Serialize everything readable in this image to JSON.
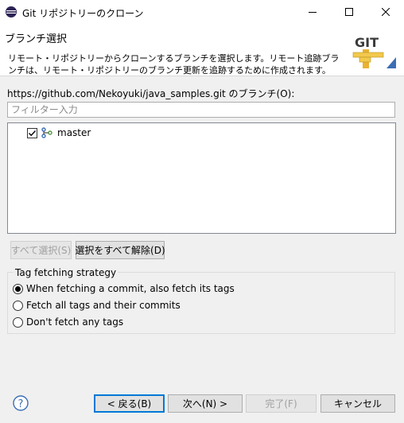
{
  "window": {
    "title": "Git リポジトリーのクローン",
    "icon": "eclipse-icon"
  },
  "banner": {
    "title": "ブランチ選択",
    "description": "リモート・リポジトリーからクローンするブランチを選択します。リモート追跡ブランチは、リモート・リポジトリーのブランチ更新を追跡するために作成されます。",
    "logo_text": "GIT"
  },
  "branches": {
    "label": "https://github.com/Nekoyuki/java_samples.git のブランチ(O):",
    "filter_placeholder": "フィルター入力",
    "items": [
      {
        "name": "master",
        "checked": true,
        "icon": "branch-icon"
      }
    ]
  },
  "selection_buttons": {
    "select_all": "すべて選択(S)",
    "deselect_all": "選択をすべて解除(D)"
  },
  "tag_strategy": {
    "legend": "Tag fetching strategy",
    "options": [
      {
        "label": "When fetching a commit, also fetch its tags",
        "selected": true
      },
      {
        "label": "Fetch all tags and their commits",
        "selected": false
      },
      {
        "label": "Don't fetch any tags",
        "selected": false
      }
    ]
  },
  "footer": {
    "help_icon": "help-icon",
    "back": "< 戻る(B)",
    "next": "次へ(N) >",
    "finish": "完了(F)",
    "cancel": "キャンセル"
  },
  "colors": {
    "accent": "#0078d7",
    "logo_bg": "#f5f5f5",
    "logo_text": "#3a3a3a"
  }
}
